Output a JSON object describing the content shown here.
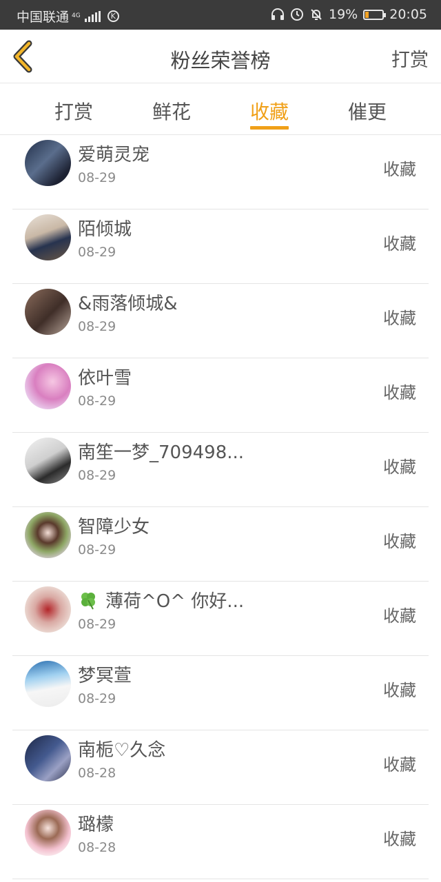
{
  "status_bar": {
    "carrier": "中国联通",
    "network": "4G",
    "k_badge": "K",
    "battery": "19%",
    "battery_level": 0.19,
    "time": "20:05",
    "icons": [
      "headset-icon",
      "alarm-icon",
      "mute-bell-icon"
    ]
  },
  "header": {
    "back_icon": "chevron-left-icon",
    "title": "粉丝荣誉榜",
    "action": "打赏"
  },
  "tabs": [
    {
      "label": "打赏"
    },
    {
      "label": "鲜花"
    },
    {
      "label": "收藏"
    },
    {
      "label": "催更"
    }
  ],
  "active_tab": "收藏",
  "accent_color": "#f0a018",
  "list": [
    {
      "name": "爱萌灵宠",
      "date": "08-29",
      "tag": "收藏"
    },
    {
      "name": "陌倾城",
      "date": "08-29",
      "tag": "收藏"
    },
    {
      "name": "&雨落倾城&",
      "date": "08-29",
      "tag": "收藏"
    },
    {
      "name": "依叶雪",
      "date": "08-29",
      "tag": "收藏"
    },
    {
      "name": "南笙一梦_709498...",
      "date": "08-29",
      "tag": "收藏"
    },
    {
      "name": "智障少女",
      "date": "08-29",
      "tag": "收藏"
    },
    {
      "name": "薄荷^O^ 你好...",
      "date": "08-29",
      "tag": "收藏",
      "icon": "clover-icon"
    },
    {
      "name": "梦冥萱",
      "date": "08-29",
      "tag": "收藏"
    },
    {
      "name": "南栀♡久念",
      "date": "08-28",
      "tag": "收藏"
    },
    {
      "name": "璐檬",
      "date": "08-28",
      "tag": "收藏"
    }
  ]
}
